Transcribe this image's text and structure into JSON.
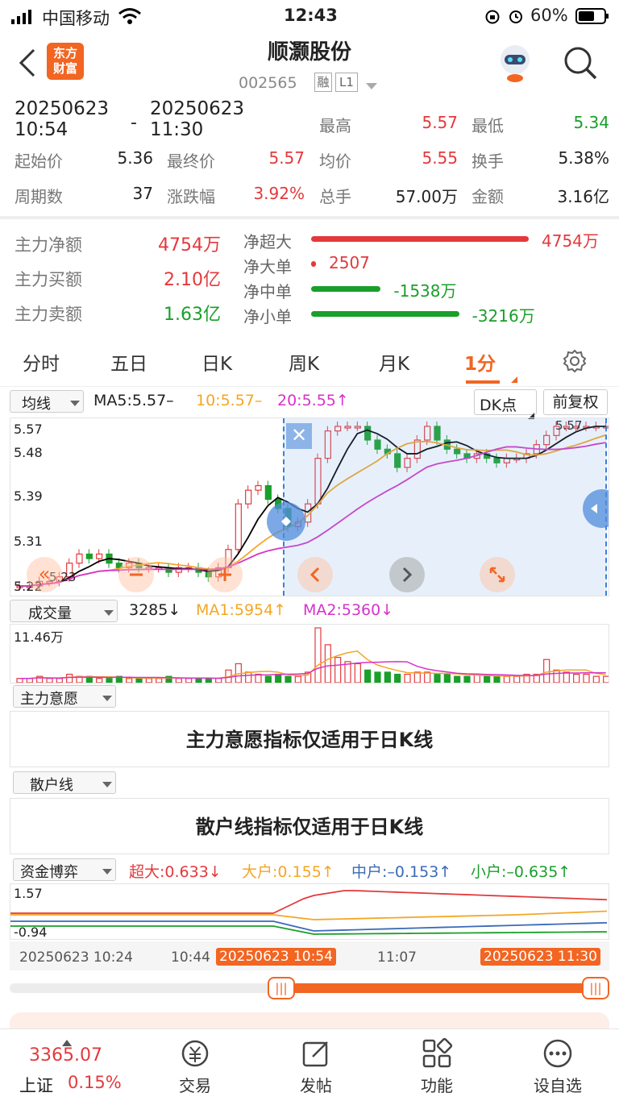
{
  "status": {
    "carrier": "中国移动",
    "time": "12:43",
    "battery": "60%"
  },
  "header": {
    "title": "顺灏股份",
    "code": "002565",
    "badge1": "融",
    "badge2": "L1",
    "logo_line1": "东方",
    "logo_line2": "财富"
  },
  "range": {
    "start_date": "20250623",
    "start_time": "10:54",
    "dash": "-",
    "end_date": "20250623",
    "end_time": "11:30"
  },
  "stats": {
    "high_label": "最高",
    "high": "5.57",
    "low_label": "最低",
    "low": "5.34",
    "open_label": "起始价",
    "open": "5.36",
    "close_label": "最终价",
    "close": "5.57",
    "avg_label": "均价",
    "avg": "5.55",
    "turn_label": "换手",
    "turn": "5.38%",
    "periods_label": "周期数",
    "periods": "37",
    "chg_label": "涨跌幅",
    "chg": "3.92%",
    "vol_label": "总手",
    "vol": "57.00万",
    "amt_label": "金额",
    "amt": "3.16亿"
  },
  "flow": {
    "net_label": "主力净额",
    "net": "4754万",
    "buy_label": "主力买额",
    "buy": "2.10亿",
    "sell_label": "主力卖额",
    "sell": "1.63亿",
    "bars": [
      {
        "label": "净超大",
        "value": "4754万",
        "fraction": 1.0,
        "color": "#e4393c"
      },
      {
        "label": "净大单",
        "value": "2507",
        "fraction": 0.0,
        "color": "#e4393c"
      },
      {
        "label": "净中单",
        "value": "-1538万",
        "fraction": 0.32,
        "color": "#1a9f2b"
      },
      {
        "label": "净小单",
        "value": "-3216万",
        "fraction": 0.68,
        "color": "#1a9f2b"
      }
    ]
  },
  "tabs": {
    "t1": "分时",
    "t2": "五日",
    "t3": "日K",
    "t4": "周K",
    "t5": "月K",
    "t6": "1分",
    "settings_icon": "gear-icon"
  },
  "kline": {
    "ind_label": "均线",
    "ma5": "MA5:5.57–",
    "ma10": "10:5.57–",
    "ma20": "20:5.55↑",
    "dk_label": "DK点",
    "fq_label": "前复权",
    "y1": "5.57",
    "y2": "5.48",
    "y3": "5.39",
    "y4": "5.31",
    "y5": "5.22",
    "low_mark": "5.23",
    "high_mark": "5.57",
    "colors": {
      "ma5": "#000000",
      "ma10": "#f5a623",
      "ma20": "#d633c9"
    }
  },
  "volume": {
    "ind_label": "成交量",
    "v": "3285↓",
    "ma1": "MA1:5954↑",
    "ma2": "MA2:5360↓",
    "ymax": "11.46万"
  },
  "zlyy": {
    "ind_label": "主力意愿",
    "msg": "主力意愿指标仅适用于日K线"
  },
  "shx": {
    "ind_label": "散户线",
    "msg": "散户线指标仅适用于日K线"
  },
  "zjby": {
    "ind_label": "资金博弈",
    "cd": "超大:0.633↓",
    "dh": "大户:0.155↑",
    "zh": "中户:–0.153↑",
    "xh": "小户:–0.635↑",
    "ytop": "1.57",
    "ybot": "-0.94"
  },
  "timeaxis": {
    "t0": "20250623 10:24",
    "t1": "10:44",
    "t2": "20250623 10:54",
    "t3": "11:07",
    "t4": "20250623 11:30"
  },
  "bottom": {
    "index_val": "3365.07",
    "index_name": "上证",
    "index_chg": "0.15%",
    "nav1": "交易",
    "nav2": "发帖",
    "nav3": "功能",
    "nav4": "设自选"
  }
}
